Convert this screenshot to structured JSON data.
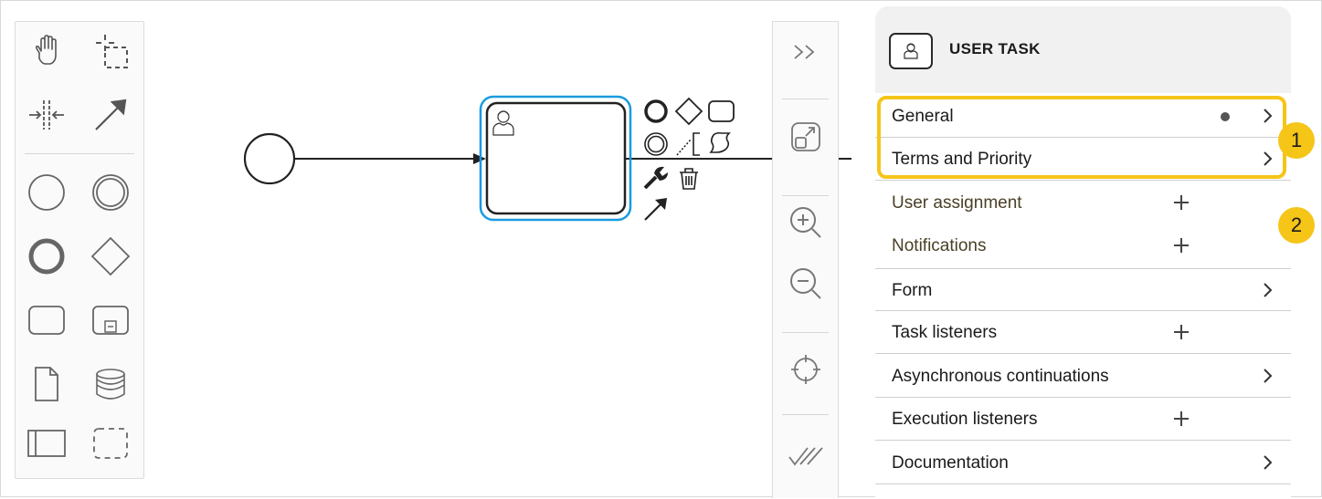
{
  "panel": {
    "title": "USER TASK",
    "title_icon": "user-task-icon",
    "rows": [
      {
        "label": "General",
        "action": "chevron",
        "has_dot": true
      },
      {
        "label": "Terms and Priority",
        "action": "chevron"
      },
      {
        "label": "User assignment",
        "action": "plus"
      },
      {
        "label": "Notifications",
        "action": "plus"
      },
      {
        "label": "Form",
        "action": "chevron"
      },
      {
        "label": "Task listeners",
        "action": "plus"
      },
      {
        "label": "Asynchronous continuations",
        "action": "chevron"
      },
      {
        "label": "Execution listeners",
        "action": "plus"
      },
      {
        "label": "Documentation",
        "action": "chevron"
      }
    ]
  },
  "annotations": {
    "badge_1": "1",
    "badge_2": "2"
  },
  "palette_tools": [
    "hand-tool-icon",
    "lasso-tool-icon",
    "space-tool-icon",
    "connect-tool-icon",
    "start-event-icon",
    "intermediate-event-icon",
    "end-event-icon",
    "gateway-icon",
    "task-icon",
    "subprocess-icon",
    "data-object-icon",
    "data-store-icon",
    "pool-icon",
    "group-icon"
  ],
  "vertical_toolbar": [
    "expand-icon",
    "fit-viewport-icon",
    "zoom-in-icon",
    "zoom-out-icon",
    "reset-position-icon",
    "validate-icon"
  ],
  "colors": {
    "highlight": "#f5c518",
    "highlight_fill": "#fdf1cf",
    "selection": "#1a9be0"
  }
}
